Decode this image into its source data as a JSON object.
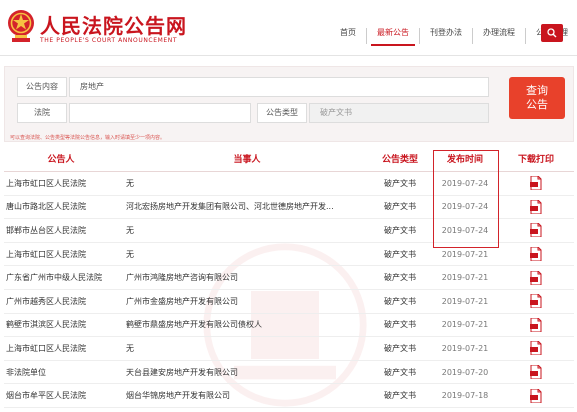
{
  "header": {
    "title": "人民法院公告网",
    "subtitle": "THE PEOPLE'S COURT ANNOUNCEMENT",
    "nav": [
      {
        "label": "首页",
        "active": false
      },
      {
        "label": "最新公告",
        "active": true
      },
      {
        "label": "刊登办法",
        "active": false
      },
      {
        "label": "办理流程",
        "active": false
      },
      {
        "label": "公告办理",
        "active": false
      }
    ]
  },
  "search": {
    "content_label": "公告内容",
    "content_value": "房地产",
    "court_label": "法院",
    "court_value": "",
    "type_label": "公告类型",
    "type_value": "破产文书",
    "submit_label_line1": "查询",
    "submit_label_line2": "公告",
    "hint": "可以查询法院、公告类型等法院公告信息，输入时请填至少一项内容。"
  },
  "table": {
    "headers": [
      "公告人",
      "当事人",
      "公告类型",
      "发布时间",
      "下载打印"
    ],
    "rows": [
      {
        "announcer": "上海市虹口区人民法院",
        "party": "无",
        "type": "破产文书",
        "date": "2019-07-24"
      },
      {
        "announcer": "唐山市路北区人民法院",
        "party": "河北宏扬房地产开发集团有限公司、河北世德房地产开发...",
        "type": "破产文书",
        "date": "2019-07-24"
      },
      {
        "announcer": "邯郸市丛台区人民法院",
        "party": "无",
        "type": "破产文书",
        "date": "2019-07-24"
      },
      {
        "announcer": "上海市虹口区人民法院",
        "party": "无",
        "type": "破产文书",
        "date": "2019-07-21"
      },
      {
        "announcer": "广东省广州市中级人民法院",
        "party": "广州市鸿隆房地产咨询有限公司",
        "type": "破产文书",
        "date": "2019-07-21"
      },
      {
        "announcer": "广州市越秀区人民法院",
        "party": "广州市金盛房地产开发有限公司",
        "type": "破产文书",
        "date": "2019-07-21"
      },
      {
        "announcer": "鹤壁市淇滨区人民法院",
        "party": "鹤壁市鼎盛房地产开发有限公司债权人",
        "type": "破产文书",
        "date": "2019-07-21"
      },
      {
        "announcer": "上海市虹口区人民法院",
        "party": "无",
        "type": "破产文书",
        "date": "2019-07-21"
      },
      {
        "announcer": "非法院单位",
        "party": "天台县建安房地产开发有限公司",
        "type": "破产文书",
        "date": "2019-07-20"
      },
      {
        "announcer": "烟台市牟平区人民法院",
        "party": "烟台华锦房地产开发有限公司",
        "type": "破产文书",
        "date": "2019-07-18"
      }
    ]
  },
  "colors": {
    "brand": "#c9151e",
    "button": "#e8412b"
  },
  "icons": {
    "search": "search-icon",
    "download": "pdf-download-icon",
    "emblem": "national-emblem-icon"
  }
}
